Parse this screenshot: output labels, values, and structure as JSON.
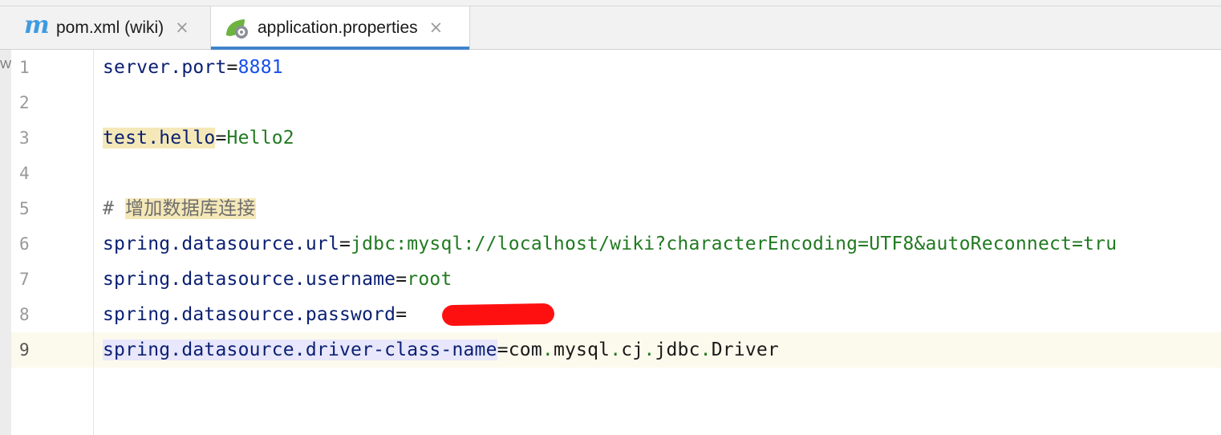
{
  "tabs": [
    {
      "icon": "maven-m-icon",
      "label": "pom.xml (wiki)",
      "active": false
    },
    {
      "icon": "spring-leaf-icon",
      "label": "application.properties",
      "active": true
    }
  ],
  "side_strip_text": "W",
  "close_glyph": "×",
  "lines": [
    {
      "number": "1",
      "key": "server.port",
      "sep": "=",
      "value": "8881"
    },
    {
      "number": "2"
    },
    {
      "number": "3",
      "key": "test.hello",
      "sep": "=",
      "value": "Hello2"
    },
    {
      "number": "4"
    },
    {
      "number": "5",
      "comment_hash": "# ",
      "comment_text": "增加数据库连接"
    },
    {
      "number": "6",
      "key": "spring.datasource.url",
      "sep": "=",
      "value": "jdbc:mysql://localhost/wiki?characterEncoding=UTF8&autoReconnect=tru"
    },
    {
      "number": "7",
      "key": "spring.datasource.username",
      "sep": "=",
      "value": "root"
    },
    {
      "number": "8",
      "key": "spring.datasource.password",
      "sep": "=",
      "value": ""
    },
    {
      "number": "9",
      "key": "spring.datasource.driver-class-name",
      "sep": "=",
      "value_parts": [
        "com",
        ".",
        "mysql",
        ".",
        "cj",
        ".",
        "jdbc",
        ".",
        "Driver"
      ]
    }
  ],
  "colors": {
    "key": "#0a1f72",
    "value": "#217a21",
    "number": "#1750eb",
    "tab_underline": "#4083c9",
    "redaction": "#ff1010"
  }
}
